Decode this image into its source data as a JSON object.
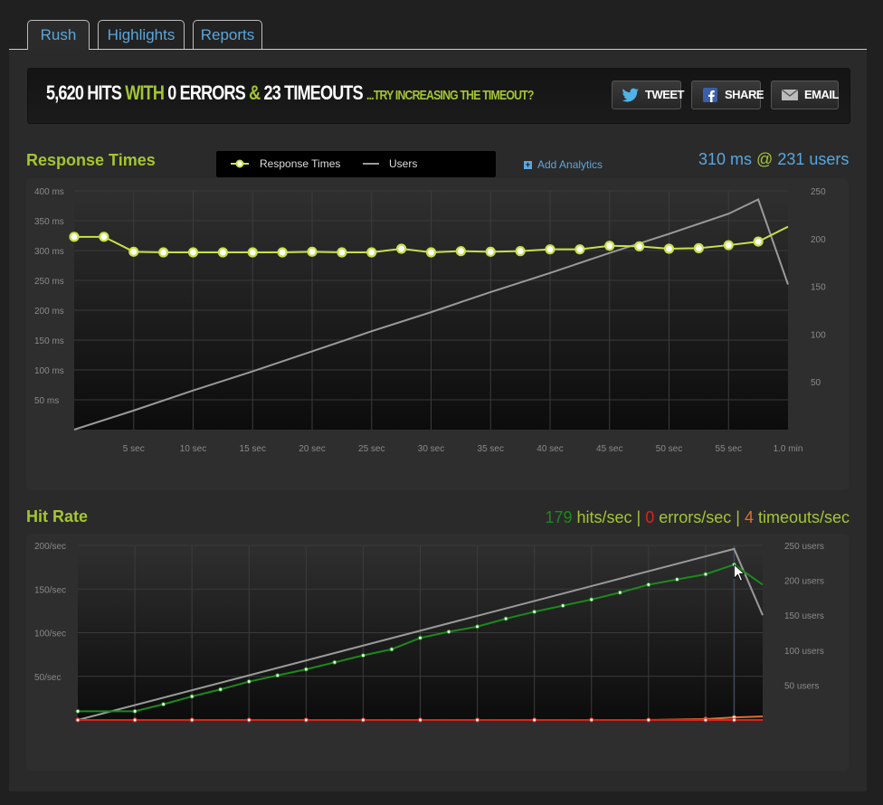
{
  "tabs": [
    {
      "label": "Rush",
      "active": true
    },
    {
      "label": "Highlights",
      "active": false
    },
    {
      "label": "Reports",
      "active": false
    }
  ],
  "banner": {
    "hits": "5,620 HITS",
    "with": "WITH",
    "errors": "0 ERRORS",
    "amp": "&",
    "timeouts": "23 TIMEOUTS",
    "hint": "...TRY INCREASING THE TIMEOUT?",
    "buttons": [
      {
        "label": "TWEET",
        "icon": "twitter-bird-icon"
      },
      {
        "label": "SHARE",
        "icon": "facebook-icon"
      },
      {
        "label": "EMAIL",
        "icon": "envelope-icon"
      }
    ]
  },
  "response": {
    "title": "Response Times",
    "legend": {
      "response_label": "Response Times",
      "users_label": "Users"
    },
    "add_analytics": "Add Analytics",
    "stat_ms": "310 ms",
    "stat_at": "@",
    "stat_users": "231 users"
  },
  "hitrate": {
    "title": "Hit Rate",
    "hits_value": "179",
    "hits_label": " hits/sec",
    "sep1": " | ",
    "errors_value": "0",
    "errors_label": " errors/sec",
    "sep2": " | ",
    "timeouts_value": "4",
    "timeouts_label": " timeouts/sec"
  },
  "colors": {
    "accent": "#a5c531",
    "blue": "#5aa6dd",
    "users_line": "#9a9a9a",
    "hits_line": "#1c8a1c",
    "errors_line": "#e02020",
    "timeouts_line": "#e0702a"
  },
  "chart_data": [
    {
      "type": "line",
      "title": "Response Times",
      "x_ticks": [
        "5 sec",
        "10 sec",
        "15 sec",
        "20 sec",
        "25 sec",
        "30 sec",
        "35 sec",
        "40 sec",
        "45 sec",
        "50 sec",
        "55 sec",
        "1.0 min"
      ],
      "y_left_ticks": [
        "400 ms",
        "350 ms",
        "300 ms",
        "250 ms",
        "200 ms",
        "150 ms",
        "100 ms",
        "50 ms"
      ],
      "y_right_ticks": [
        "250",
        "200",
        "150",
        "100",
        "50"
      ],
      "ylim_left": [
        0,
        400
      ],
      "ylim_right": [
        0,
        250
      ],
      "xlim": [
        0,
        60
      ],
      "series": [
        {
          "name": "Response Times",
          "axis": "left",
          "x": [
            0,
            2.5,
            5,
            7.5,
            10,
            12.5,
            15,
            17.5,
            20,
            22.5,
            25,
            27.5,
            30,
            32.5,
            35,
            37.5,
            40,
            42.5,
            45,
            47.5,
            50,
            52.5,
            55,
            57.5,
            60
          ],
          "y": [
            323,
            323,
            298,
            297,
            297,
            297,
            297,
            297,
            298,
            297,
            297,
            303,
            297,
            299,
            298,
            299,
            302,
            302,
            308,
            307,
            303,
            304,
            309,
            315,
            340
          ]
        },
        {
          "name": "Users",
          "axis": "right",
          "x": [
            0,
            5,
            10,
            15,
            20,
            25,
            30,
            35,
            40,
            45,
            50,
            55,
            57.5,
            60
          ],
          "y": [
            0,
            20,
            41,
            61,
            82,
            103,
            123,
            144,
            164,
            185,
            205,
            226,
            241,
            152
          ]
        }
      ]
    },
    {
      "type": "line",
      "title": "Hit Rate",
      "y_left_ticks": [
        "200/sec",
        "150/sec",
        "100/sec",
        "50/sec"
      ],
      "y_right_ticks": [
        "250 users",
        "200 users",
        "150 users",
        "100 users",
        "50 users"
      ],
      "ylim_left": [
        0,
        200
      ],
      "ylim_right": [
        0,
        250
      ],
      "xlim": [
        0,
        60
      ],
      "series": [
        {
          "name": "hits/sec",
          "axis": "left",
          "x": [
            0,
            5,
            7.5,
            10,
            12.5,
            15,
            17.5,
            20,
            22.5,
            25,
            27.5,
            30,
            32.5,
            35,
            37.5,
            40,
            42.5,
            45,
            47.5,
            50,
            52.5,
            55,
            57.5,
            60
          ],
          "y": [
            10,
            10,
            18,
            27,
            35,
            44,
            51,
            58,
            66,
            74,
            81,
            94,
            101,
            107,
            116,
            124,
            131,
            138,
            146,
            155,
            161,
            167,
            178,
            155
          ]
        },
        {
          "name": "errors/sec",
          "axis": "left",
          "x": [
            0,
            5,
            10,
            15,
            20,
            25,
            30,
            35,
            40,
            45,
            50,
            55,
            57.5,
            60
          ],
          "y": [
            0,
            0,
            0,
            0,
            0,
            0,
            0,
            0,
            0,
            0,
            0,
            0,
            0,
            0
          ]
        },
        {
          "name": "timeouts/sec",
          "axis": "left",
          "x": [
            0,
            5,
            10,
            15,
            20,
            25,
            30,
            35,
            40,
            45,
            50,
            55,
            57.5,
            60
          ],
          "y": [
            0,
            0,
            0,
            0,
            0,
            0,
            0,
            0,
            0,
            0,
            0,
            1,
            3,
            4
          ]
        },
        {
          "name": "users",
          "axis": "right",
          "x": [
            0,
            57.5,
            60
          ],
          "y": [
            0,
            245,
            150
          ]
        }
      ]
    }
  ]
}
